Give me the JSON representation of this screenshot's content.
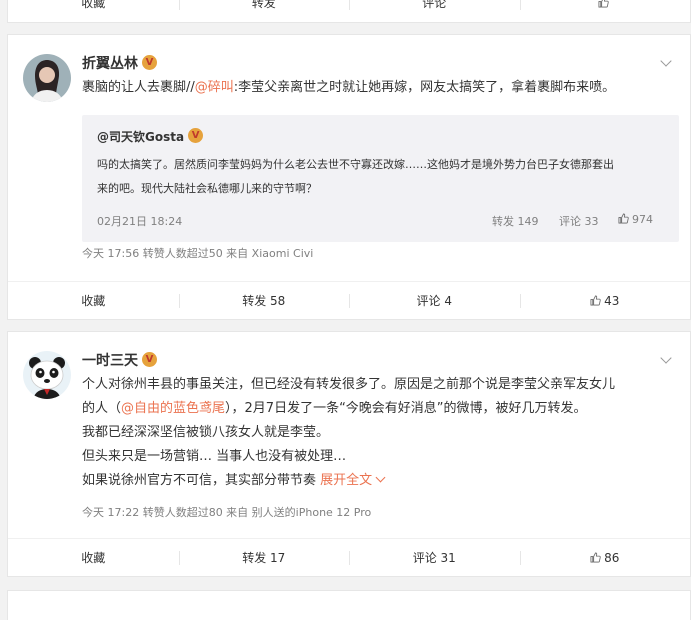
{
  "top_bar": {
    "collect": "收藏",
    "repost": "转发",
    "comment": "评论"
  },
  "post1": {
    "author": "折翼丛林",
    "text_prefix": "裹脑的让人去裹脚//",
    "mention": "@碎叫",
    "text_suffix": ":李莹父亲离世之时就让她再嫁，网友太搞笑了，拿着裹脚布来喷。",
    "quote": {
      "author": "@司天钦Gosta",
      "line1": "吗的太搞笑了。居然质问李莹妈妈为什么老公去世不守寡还改嫁……这他妈才是境外势力台巴子女德那套出",
      "line2": "来的吧。现代大陆社会私德哪儿来的守节啊？",
      "date": "02月21日 18:24",
      "repost": "转发 149",
      "comment": "评论 33",
      "likes": "974"
    },
    "meta": "今天 17:56 转赞人数超过50  来自 Xiaomi Civi",
    "actions": {
      "collect": "收藏",
      "repost": "转发 58",
      "comment": "评论 4",
      "likes": "43"
    }
  },
  "post2": {
    "author": "一时三天",
    "line1": "个人对徐州丰县的事虽关注，但已经没有转发很多了。原因是之前那个说是李莹父亲军友女儿",
    "line2_prefix": "的人（",
    "line2_mention": "@自由的蓝色鸢尾",
    "line2_suffix": "），2月7日发了一条“今晚会有好消息”的微博，被好几万转发。",
    "line3": "我都已经深深坚信被锁八孩女人就是李莹。",
    "line4": "但头来只是一场营销… 当事人也没有被处理…",
    "line5": "如果说徐州官方不可信，其实部分带节奏",
    "expand": "展开全文",
    "meta": "今天 17:22 转赞人数超过80  来自 别人送的iPhone 12 Pro",
    "actions": {
      "collect": "收藏",
      "repost": "转发 17",
      "comment": "评论 31",
      "likes": "86"
    }
  }
}
